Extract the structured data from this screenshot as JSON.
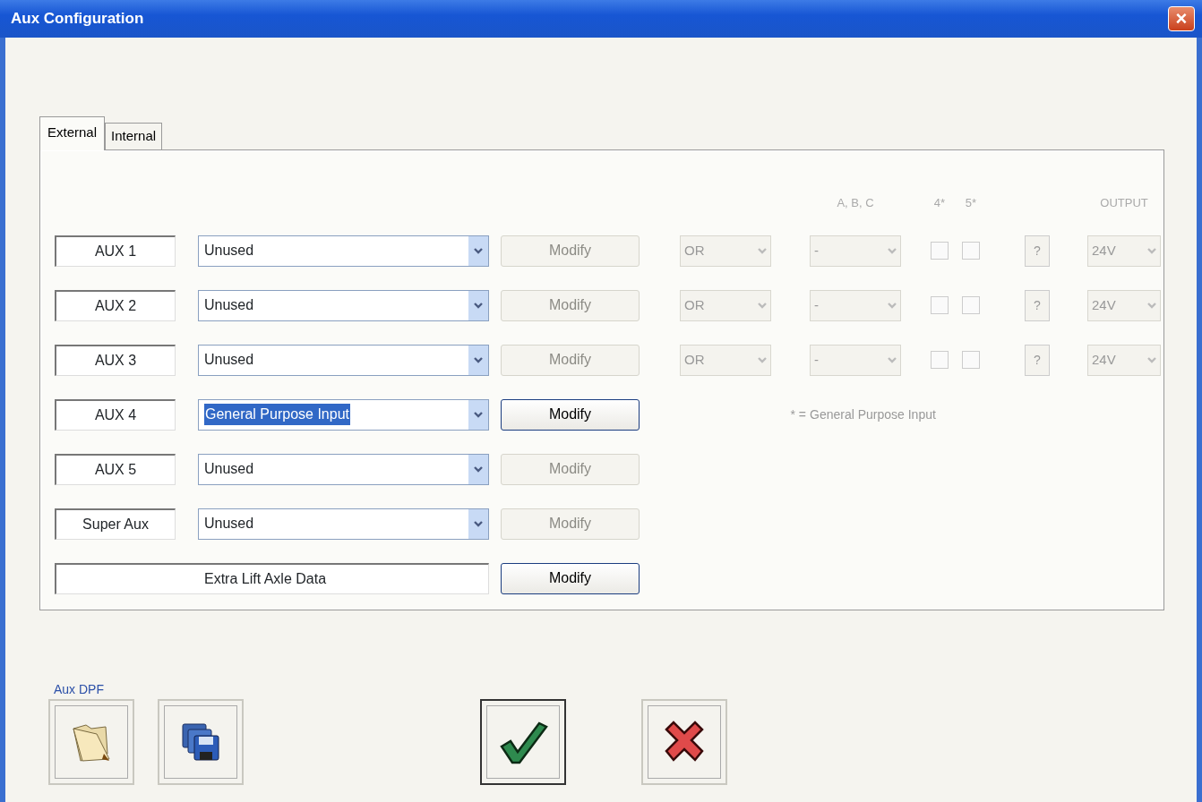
{
  "window": {
    "title": "Aux Configuration",
    "close": "×"
  },
  "tabs": [
    {
      "label": "External",
      "selected": true
    },
    {
      "label": "Internal",
      "selected": false
    }
  ],
  "columns": [
    "A, B, C",
    "4*",
    "5*",
    "OUTPUT"
  ],
  "rows": [
    {
      "kind": "aux",
      "label": "AUX 1",
      "value": "Unused",
      "text_selected": false,
      "modify": {
        "label": "Modify",
        "disabled": true
      },
      "options": {
        "disabled": true,
        "logic": "OR",
        "abc": "-",
        "check4": false,
        "check5": false,
        "help": "?",
        "output": "24V"
      }
    },
    {
      "kind": "aux",
      "label": "AUX 2",
      "value": "Unused",
      "text_selected": false,
      "modify": {
        "label": "Modify",
        "disabled": true
      },
      "options": {
        "disabled": true,
        "logic": "OR",
        "abc": "-",
        "check4": false,
        "check5": false,
        "help": "?",
        "output": "24V"
      }
    },
    {
      "kind": "aux",
      "label": "AUX 3",
      "value": "Unused",
      "text_selected": false,
      "modify": {
        "label": "Modify",
        "disabled": true
      },
      "options": {
        "disabled": true,
        "logic": "OR",
        "abc": "-",
        "check4": false,
        "check5": false,
        "help": "?",
        "output": "24V"
      }
    },
    {
      "kind": "aux",
      "label": "AUX 4",
      "value": "General Purpose Input",
      "text_selected": true,
      "modify": {
        "label": "Modify",
        "disabled": false
      },
      "note": {
        "marker": "* =",
        "text": "General Purpose Input"
      }
    },
    {
      "kind": "aux",
      "label": "AUX 5",
      "value": "Unused",
      "text_selected": false,
      "modify": {
        "label": "Modify",
        "disabled": true
      }
    },
    {
      "kind": "aux",
      "label": "Super Aux",
      "value": "Unused",
      "text_selected": false,
      "modify": {
        "label": "Modify",
        "disabled": true
      }
    },
    {
      "kind": "extra",
      "text": "Extra Lift Axle Data",
      "modify": {
        "label": "Modify",
        "disabled": false
      }
    }
  ],
  "aux_dpf": {
    "label": "Aux DPF",
    "buttons": [
      {
        "kind": "open"
      },
      {
        "kind": "save"
      }
    ]
  },
  "footer": [
    {
      "kind": "ok",
      "default": true
    },
    {
      "kind": "cancel",
      "default": false
    }
  ]
}
